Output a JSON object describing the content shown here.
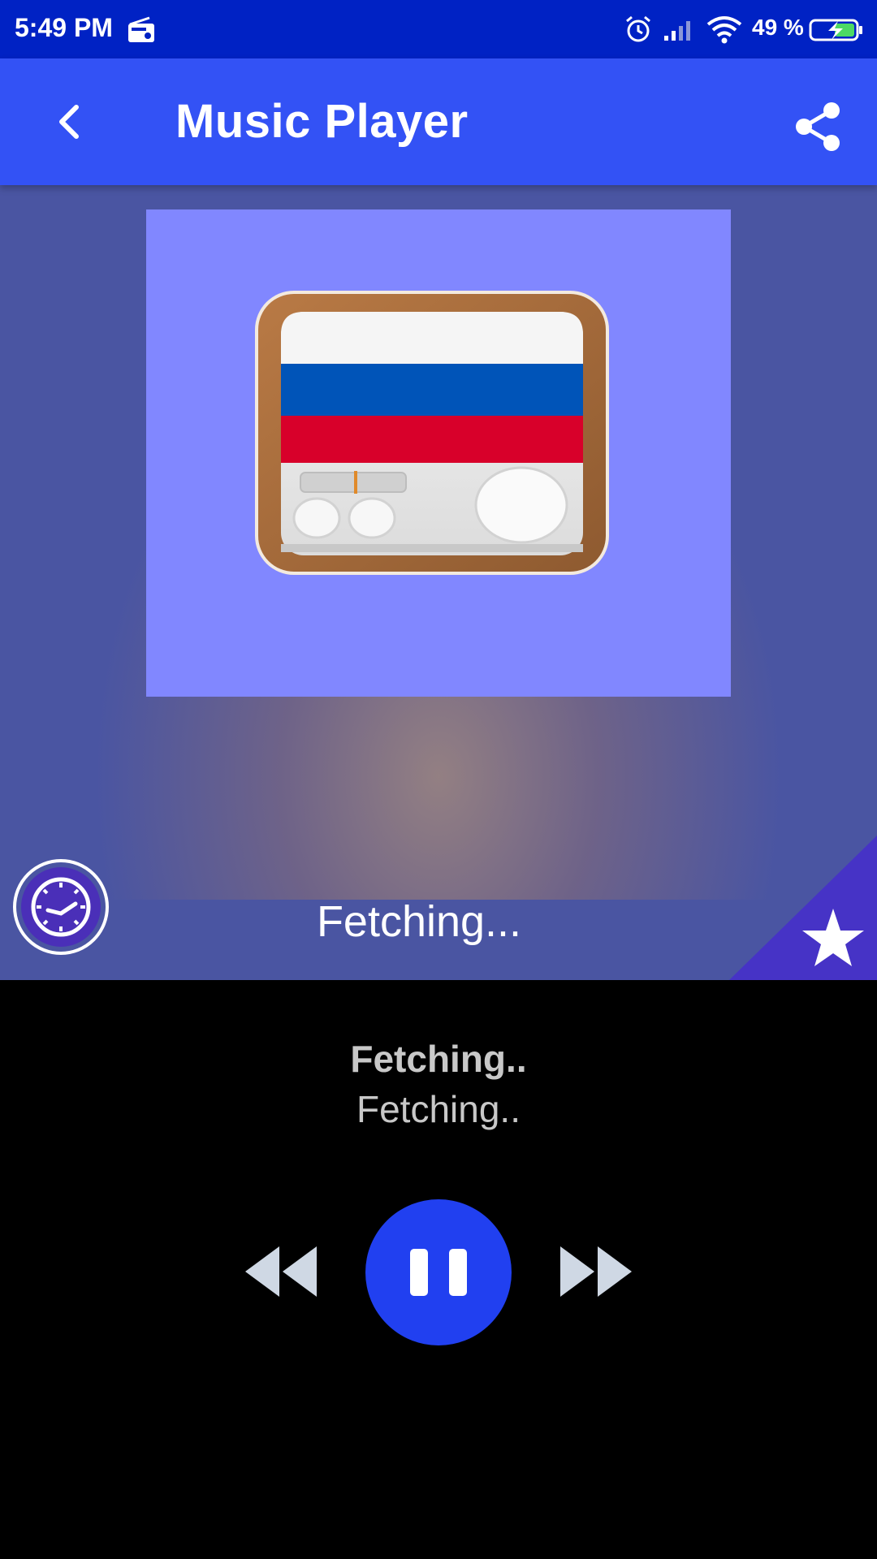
{
  "status_bar": {
    "time": "5:49 PM",
    "battery": "49 %",
    "icons": [
      "radio-icon",
      "alarm-icon",
      "signal-icon",
      "wifi-icon",
      "battery-charging-icon"
    ]
  },
  "app_bar": {
    "title": "Music Player",
    "back_icon": "chevron-left-icon",
    "share_icon": "share-icon",
    "color": "#3352f5"
  },
  "album": {
    "background_color": "#8187ff",
    "artwork_icon": "russia-radio-icon",
    "status_text": "Fetching...",
    "timer_icon": "clock-icon",
    "favorite_icon": "star-icon"
  },
  "player": {
    "title": "Fetching..",
    "subtitle": "Fetching..",
    "controls": {
      "previous_icon": "rewind-icon",
      "play_pause_icon": "pause-icon",
      "next_icon": "fast-forward-icon"
    },
    "accent_color": "#2140f0"
  }
}
